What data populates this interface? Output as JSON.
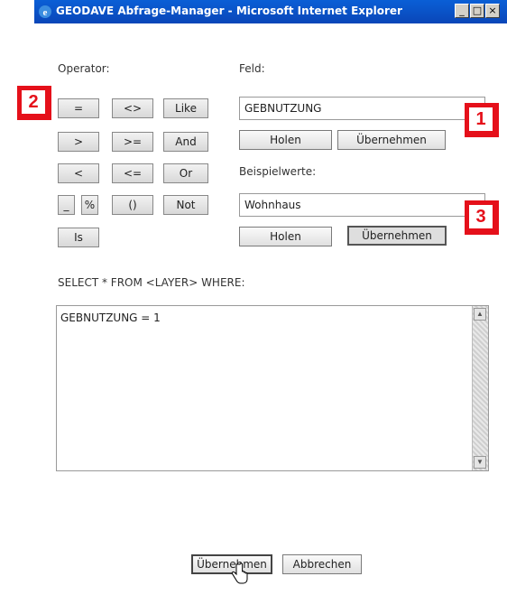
{
  "window": {
    "title": "GEODAVE Abfrage-Manager - Microsoft Internet Explorer",
    "buttons": {
      "minimize": "_",
      "maximize": "□",
      "close": "×"
    }
  },
  "operator": {
    "label": "Operator:",
    "buttons": [
      "=",
      "<>",
      "Like",
      ">",
      ">=",
      "And",
      "<",
      "<=",
      "Or",
      "_",
      "%",
      "()",
      "Not",
      "Is"
    ]
  },
  "field": {
    "label": "Feld:",
    "value": "GEBNUTZUNG",
    "holen": "Holen",
    "uebernehmen": "Übernehmen"
  },
  "example": {
    "label": "Beispielwerte:",
    "value": "Wohnhaus",
    "holen": "Holen",
    "uebernehmen": "Übernehmen"
  },
  "query": {
    "label": "SELECT * FROM <LAYER> WHERE:",
    "text": "GEBNUTZUNG = 1"
  },
  "footer": {
    "uebernehmen": "Übernehmen",
    "abbrechen": "Abbrechen"
  },
  "badges": [
    "1",
    "2",
    "3"
  ],
  "colors": {
    "titlebar": "#0a46b8",
    "badge": "#e5101a"
  }
}
